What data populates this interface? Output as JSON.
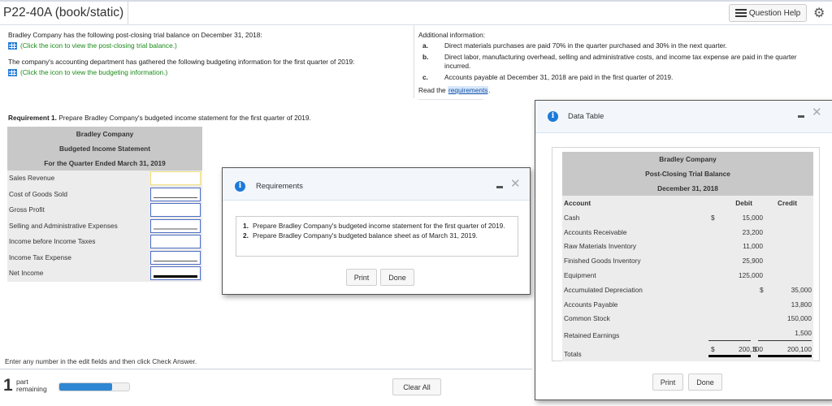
{
  "header": {
    "title": "P22-40A (book/static)",
    "question_help_label": "Question Help",
    "question_help_icon": "list-icon",
    "settings_icon": "gear-icon"
  },
  "left_info": {
    "line1": "Bradley Company has the following post-closing trial balance on December 31, 2018:",
    "link1": "(Click the icon to view the post-closing trial balance.)",
    "line2": "The company's accounting department has gathered the following budgeting information for the first quarter of 2019:",
    "link2": "(Click the icon to view the budgeting information.)",
    "link_icon": "table-grid-icon"
  },
  "additional_info": {
    "heading": "Additional information:",
    "items": [
      {
        "label": "a.",
        "text": "Direct materials purchases are paid 70% in the quarter purchased and 30% in the next quarter."
      },
      {
        "label": "b.",
        "text": "Direct labor, manufacturing overhead, selling and administrative costs, and income tax expense are paid in the quarter incurred."
      },
      {
        "label": "c.",
        "text": "Accounts payable at December 31, 2018 are paid in the first quarter of 2019."
      }
    ],
    "read_prefix": "Read the ",
    "read_link": "requirements",
    "read_suffix": "."
  },
  "requirement": {
    "label": "Requirement 1.",
    "text": " Prepare Bradley Company's budgeted income statement for the first quarter of 2019."
  },
  "income_statement": {
    "company": "Bradley Company",
    "title": "Budgeted Income Statement",
    "period": "For the Quarter Ended March 31, 2019",
    "rows": [
      {
        "label": "Sales Revenue",
        "value": ""
      },
      {
        "label": "Cost of Goods Sold",
        "value": ""
      },
      {
        "label": "Gross Profit",
        "value": ""
      },
      {
        "label": "Selling and Administrative Expenses",
        "value": ""
      },
      {
        "label": "Income before Income Taxes",
        "value": ""
      },
      {
        "label": "Income Tax Expense",
        "value": ""
      },
      {
        "label": "Net Income",
        "value": ""
      }
    ]
  },
  "footer": {
    "instruction": "Enter any number in the edit fields and then click Check Answer.",
    "parts_count": "1",
    "parts_label_1": "part",
    "parts_label_2": "remaining",
    "progress_percent": 75,
    "clear_all_label": "Clear All"
  },
  "requirements_modal": {
    "title": "Requirements",
    "items": [
      {
        "num": "1.",
        "text": "Prepare Bradley Company's budgeted income statement for the first quarter of 2019."
      },
      {
        "num": "2.",
        "text": "Prepare Bradley Company's budgeted balance sheet as of March 31, 2019."
      }
    ],
    "print_label": "Print",
    "done_label": "Done"
  },
  "data_table_modal": {
    "title": "Data Table",
    "company": "Bradley Company",
    "report": "Post-Closing Trial Balance",
    "date": "December 31, 2018",
    "columns": {
      "account": "Account",
      "debit": "Debit",
      "credit": "Credit"
    },
    "rows": [
      {
        "account": "Cash",
        "debit_sym": "$",
        "debit": "15,000",
        "credit_sym": "",
        "credit": ""
      },
      {
        "account": "Accounts Receivable",
        "debit_sym": "",
        "debit": "23,200",
        "credit_sym": "",
        "credit": ""
      },
      {
        "account": "Raw Materials Inventory",
        "debit_sym": "",
        "debit": "11,000",
        "credit_sym": "",
        "credit": ""
      },
      {
        "account": "Finished Goods Inventory",
        "debit_sym": "",
        "debit": "25,900",
        "credit_sym": "",
        "credit": ""
      },
      {
        "account": "Equipment",
        "debit_sym": "",
        "debit": "125,000",
        "credit_sym": "",
        "credit": ""
      },
      {
        "account": "Accumulated Depreciation",
        "debit_sym": "",
        "debit": "",
        "credit_sym": "$",
        "credit": "35,000"
      },
      {
        "account": "Accounts Payable",
        "debit_sym": "",
        "debit": "",
        "credit_sym": "",
        "credit": "13,800"
      },
      {
        "account": "Common Stock",
        "debit_sym": "",
        "debit": "",
        "credit_sym": "",
        "credit": "150,000"
      },
      {
        "account": "Retained Earnings",
        "debit_sym": "",
        "debit": "",
        "credit_sym": "",
        "credit": "1,500"
      }
    ],
    "totals": {
      "account": "Totals",
      "debit_sym": "$",
      "debit": "200,100",
      "credit_sym": "$",
      "credit": "200,100"
    },
    "print_label": "Print",
    "done_label": "Done"
  }
}
